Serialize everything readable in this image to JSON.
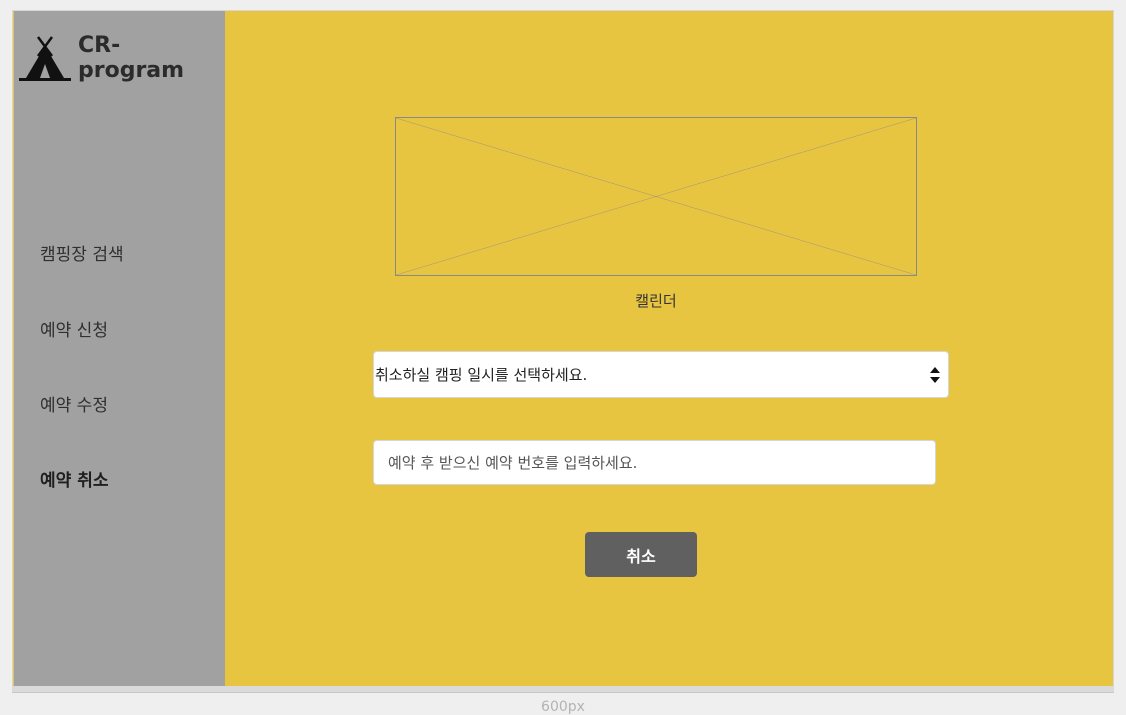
{
  "sidebar": {
    "logo_text": "CR-program",
    "logo_icon": "tent-icon",
    "items": [
      {
        "label": "캠핑장 검색",
        "active": false
      },
      {
        "label": "예약 신청",
        "active": false
      },
      {
        "label": "예약 수정",
        "active": false
      },
      {
        "label": "예약 취소",
        "active": true
      }
    ]
  },
  "main": {
    "calendar_caption": "캘린더",
    "date_select": {
      "value": "취소하실 캠핑 일시를 선택하세요."
    },
    "reservation_input": {
      "placeholder": "예약 후 받으신 예약 번호를 입력하세요.",
      "value": ""
    },
    "cancel_label": "취소"
  },
  "footer": {
    "width_label": "600px"
  },
  "colors": {
    "main_bg": "#e8c541",
    "sidebar_bg": "#a1a1a1",
    "button_bg": "#606060"
  }
}
